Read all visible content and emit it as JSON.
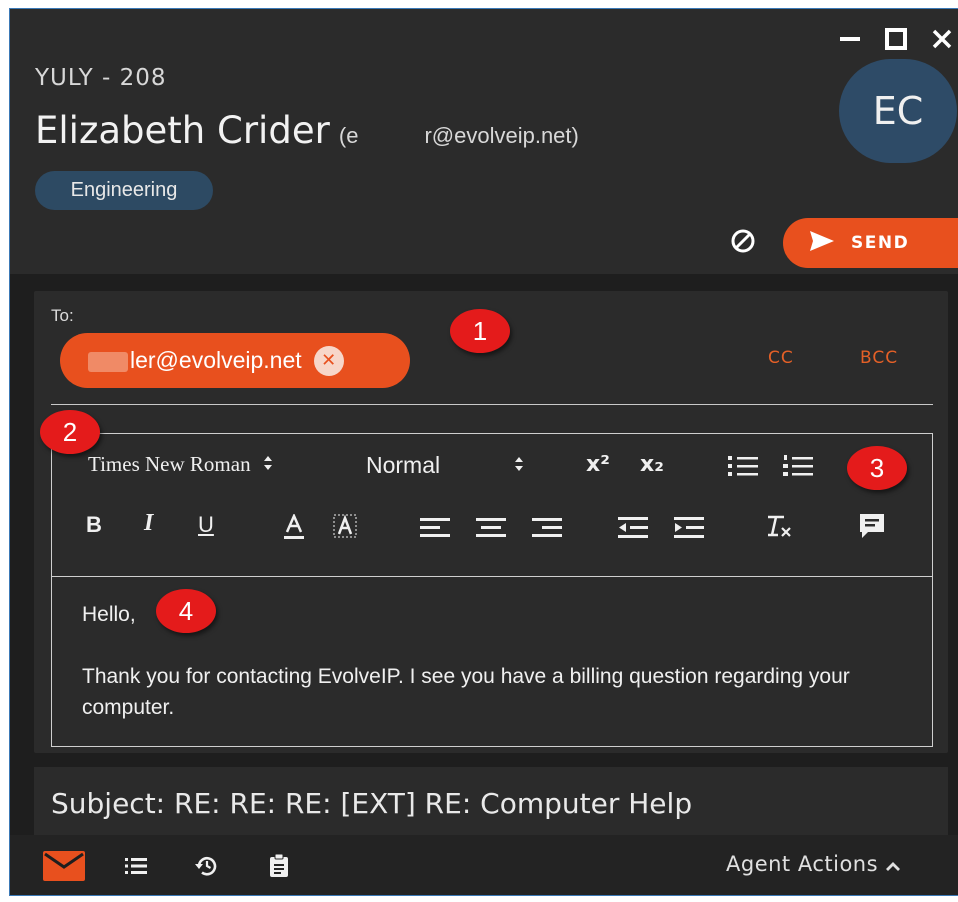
{
  "header": {
    "queue_id": "YULY - 208",
    "contact_name": "Elizabeth Crider",
    "contact_email": "(e      r@evolveip.net)",
    "tag": "Engineering",
    "avatar_initials": "EC",
    "send_label": "SEND",
    "window_controls": [
      "minimize-icon",
      "maximize-icon",
      "close-icon"
    ]
  },
  "compose": {
    "to_label": "To:",
    "recipient": "ler@evolveip.net",
    "cc_label": "CC",
    "bcc_label": "BCC",
    "toolbar": {
      "font": "Times New Roman",
      "size": "Normal",
      "superscript": "x²",
      "subscript": "x₂",
      "bold": "B",
      "italic": "I",
      "underline": "U"
    },
    "body": {
      "greeting": "Hello,",
      "paragraph": "Thank you for contacting EvolveIP.  I see you have a billing question regarding your computer."
    }
  },
  "subject": {
    "text": "Subject: RE: RE: RE: [EXT] RE: Computer Help"
  },
  "footer": {
    "agent_actions": "Agent Actions",
    "icons": [
      "email-icon",
      "list-icon",
      "history-icon",
      "clipboard-icon"
    ]
  },
  "markers": [
    "1",
    "2",
    "3",
    "4"
  ],
  "colors": {
    "accent": "#e8501e",
    "marker": "#e41b1b",
    "tag_bg": "#2d4a63",
    "avatar_bg": "#2e4b67"
  }
}
